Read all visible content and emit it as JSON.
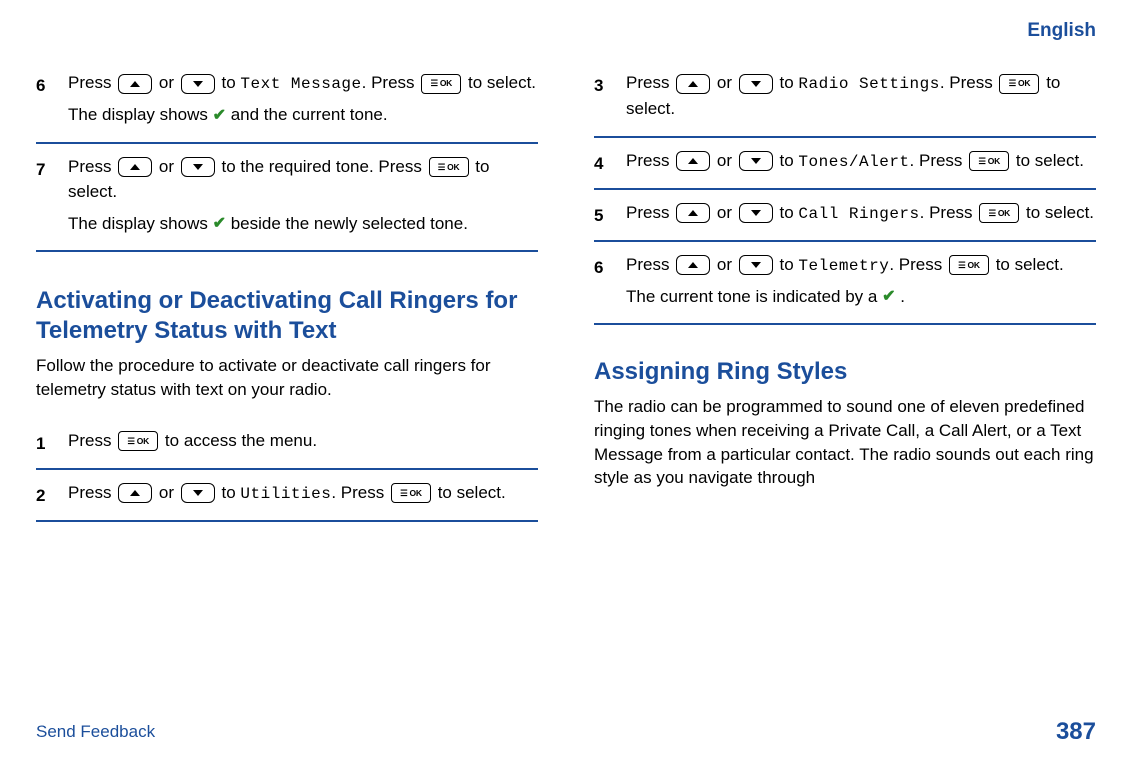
{
  "header": {
    "language": "English"
  },
  "left": {
    "step6": {
      "num": "6",
      "pre": "Press ",
      "mid": " or ",
      "to": " to ",
      "target": "Text Message",
      "post1": ". Press ",
      "post2": " to select.",
      "line2_pre": "The display shows ",
      "line2_post": " and the current tone."
    },
    "step7": {
      "num": "7",
      "pre": "Press ",
      "mid": " or ",
      "to": " to the required tone. Press ",
      "post": " to select.",
      "line2_pre": "The display shows ",
      "line2_post": " beside the newly selected tone."
    },
    "heading1": "Activating or Deactivating Call Ringers for Telemetry Status with Text",
    "intro1": "Follow the procedure to activate or deactivate call ringers for telemetry status with text on your radio.",
    "step1": {
      "num": "1",
      "pre": "Press ",
      "post": " to access the menu."
    },
    "step2": {
      "num": "2",
      "pre": "Press ",
      "mid": " or ",
      "to": " to ",
      "target": "Utilities",
      "post1": ". Press ",
      "post2": " to select."
    }
  },
  "right": {
    "step3": {
      "num": "3",
      "pre": "Press ",
      "mid": " or ",
      "to": " to ",
      "target": "Radio Settings",
      "post1": ". Press ",
      "post2": " to select."
    },
    "step4": {
      "num": "4",
      "pre": "Press ",
      "mid": " or ",
      "to": " to ",
      "target": "Tones/Alert",
      "post1": ". Press ",
      "post2": " to select."
    },
    "step5": {
      "num": "5",
      "pre": "Press ",
      "mid": " or ",
      "to": " to ",
      "target": "Call Ringers",
      "post1": ". Press ",
      "post2": " to select."
    },
    "step6": {
      "num": "6",
      "pre": "Press ",
      "mid": " or ",
      "to": " to ",
      "target": "Telemetry",
      "post1": ". Press ",
      "post2": " to select.",
      "line2_pre": "The current tone is indicated by a ",
      "line2_post": " ."
    },
    "heading2": "Assigning Ring Styles",
    "intro2": "The radio can be programmed to sound one of eleven predefined ringing tones when receiving a Private Call, a Call Alert, or a Text Message from a particular contact. The radio sounds out each ring style as you navigate through"
  },
  "footer": {
    "link": "Send Feedback",
    "page": "387"
  }
}
